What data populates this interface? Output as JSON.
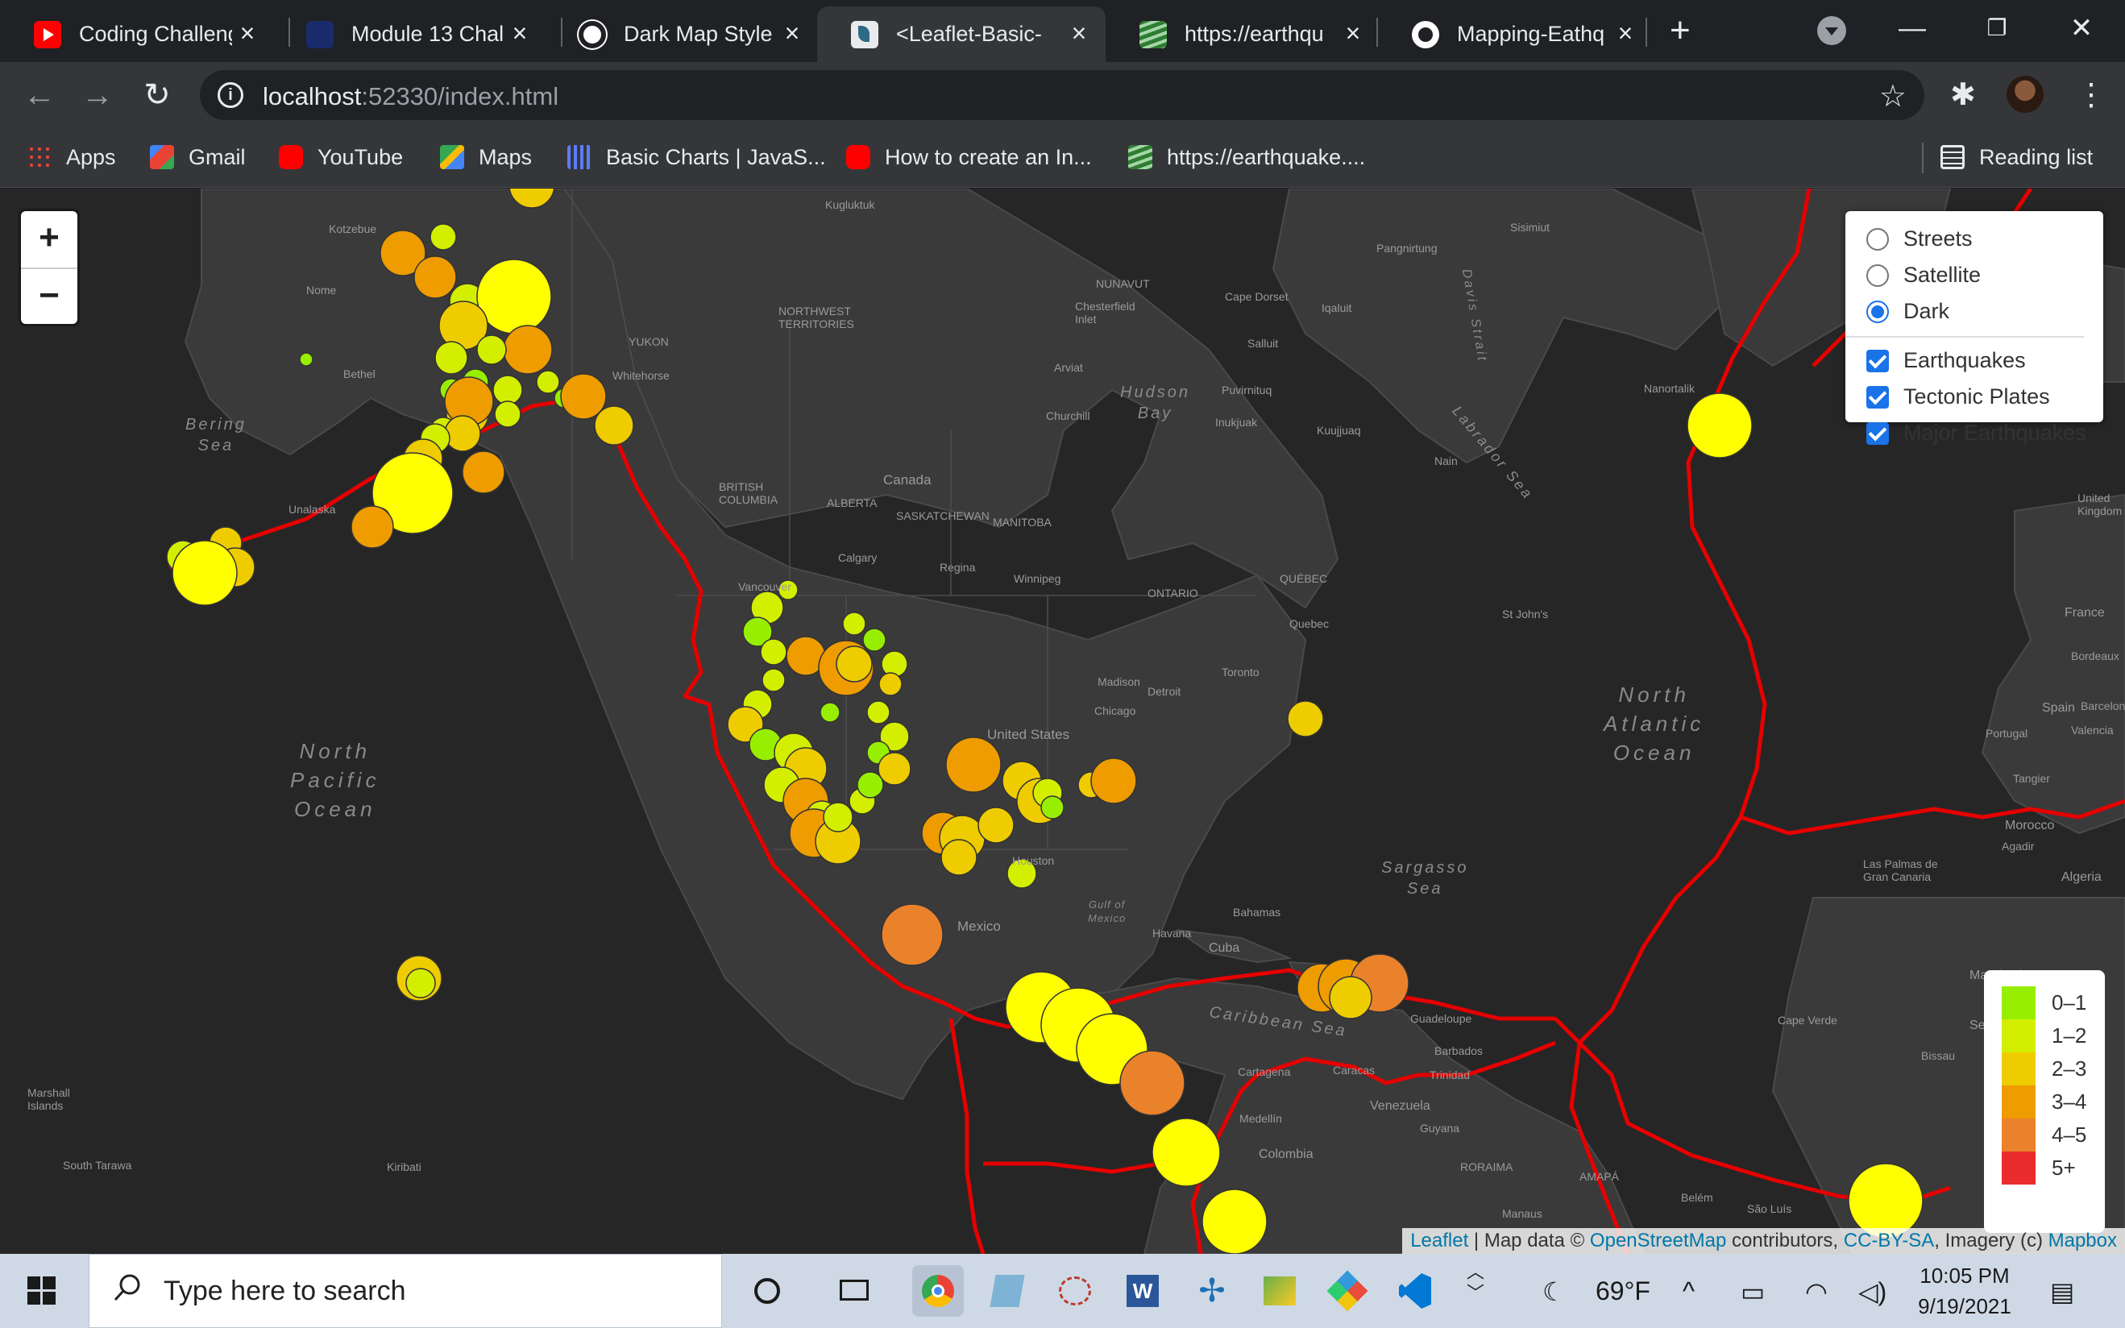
{
  "browser": {
    "tabs": [
      {
        "label": "Coding Challeng",
        "icon": "youtube-icon",
        "active": false
      },
      {
        "label": "Module 13 Chal",
        "icon": "module-icon",
        "active": false
      },
      {
        "label": "Dark Map Style",
        "icon": "mapbox-icon",
        "active": false
      },
      {
        "label": "<Leaflet-Basic-",
        "icon": "leaflet-icon",
        "active": true
      },
      {
        "label": "https://earthqu",
        "icon": "usgs-icon",
        "active": false
      },
      {
        "label": "Mapping-Eathq",
        "icon": "github-icon",
        "active": false
      }
    ],
    "new_tab": "+",
    "url_host": "localhost",
    "url_rest": ":52330/index.html",
    "bookmarks": [
      {
        "label": "Apps"
      },
      {
        "label": "Gmail"
      },
      {
        "label": "YouTube"
      },
      {
        "label": "Maps"
      },
      {
        "label": "Basic Charts | JavaS..."
      },
      {
        "label": "How to create an In..."
      },
      {
        "label": "https://earthquake...."
      }
    ],
    "reading_list": "Reading list"
  },
  "map": {
    "zoom_in": "+",
    "zoom_out": "−",
    "layers": {
      "base": [
        {
          "label": "Streets",
          "checked": false
        },
        {
          "label": "Satellite",
          "checked": false
        },
        {
          "label": "Dark",
          "checked": true
        }
      ],
      "overlays": [
        {
          "label": "Earthquakes",
          "checked": true
        },
        {
          "label": "Tectonic Plates",
          "checked": true
        },
        {
          "label": "Major Earthquakes",
          "checked": true
        }
      ]
    },
    "legend": [
      {
        "label": "0–1",
        "color": "#98ee00"
      },
      {
        "label": "1–2",
        "color": "#d4ee00"
      },
      {
        "label": "2–3",
        "color": "#eecc00"
      },
      {
        "label": "3–4",
        "color": "#ee9c00"
      },
      {
        "label": "4–5",
        "color": "#ea822c"
      },
      {
        "label": "5+",
        "color": "#ea2c2c"
      }
    ],
    "ocean_labels": {
      "north_pacific": "North\nPacific\nOcean",
      "north_atlantic": "North\nAtlantic\nOcean",
      "bering": "Bering\nSea",
      "hudson": "Hudson\nBay",
      "caribbean": "Caribbean Sea",
      "sargasso": "Sargasso\nSea",
      "labrador": "Labrador Sea",
      "davis": "Davis Strait",
      "gulf": "Gulf of\nMexico"
    },
    "place_labels": {
      "canada": "Canada",
      "united_states": "United States",
      "mexico": "Mexico",
      "venezuela": "Venezuela",
      "colombia": "Colombia",
      "cuba": "Cuba",
      "havana": "Havana",
      "calgary": "Calgary",
      "vancouver": "Vancouver",
      "chicago": "Chicago",
      "detroit": "Detroit",
      "toronto": "Toronto",
      "quebec": "Quebec",
      "houston": "Houston",
      "medellin": "Medellín",
      "caracas": "Caracas",
      "belem": "Belém",
      "sao_luis": "São Luís",
      "manaus": "Manaus",
      "st_johns": "St John's",
      "nome": "Nome",
      "bethel": "Bethel",
      "kotzebue": "Kotzebue",
      "whitehorse": "Whitehorse",
      "yukon": "YUKON",
      "nunavut": "NUNAVUT",
      "alberta": "ALBERTA",
      "ontario": "ONTARIO",
      "quebec_prov": "QUÉBEC",
      "manitoba": "MANITOBA",
      "saskatchewan": "SASKATCHEWAN",
      "bc": "BRITISH\nCOLUMBIA",
      "nwt": "NORTHWEST\nTERRITORIES",
      "winnipeg": "Winnipeg",
      "regina": "Regina",
      "churchill": "Churchill",
      "iqaluit": "Iqaluit",
      "kugluktuk": "Kugluktuk",
      "salluit": "Salluit",
      "inukjuak": "Inukjuak",
      "puvirnituq": "Puvirnituq",
      "kuujjuaq": "Kuujjuaq",
      "nain": "Nain",
      "nanortalik": "Nanortalik",
      "sisimiut": "Sisimiut",
      "pangnirtung": "Pangnirtung",
      "cape_dorset": "Cape Dorset",
      "chesterfield": "Chesterfield\nInlet",
      "arviat": "Arviat",
      "marshall": "Marshall\nIslands",
      "south_tarawa": "South Tarawa",
      "kiribati": "Kiribati",
      "madison": "Madison",
      "france": "France",
      "spain": "Spain",
      "portugal": "Portugal",
      "morocco": "Morocco",
      "algeria": "Algeria",
      "senegal": "Senegal",
      "mauritania": "Mauritania",
      "united_kingdom": "United\nKingdom",
      "bordeaux": "Bordeaux",
      "barcelona": "Barcelona",
      "valencia": "Valencia",
      "tangier": "Tangier",
      "agadir": "Agadir",
      "las_palmas": "Las Palmas de\nGran Canaria",
      "cape_verde": "Cape Verde",
      "bissau": "Bissau",
      "guyana": "Guyana",
      "roraima": "RORAIMA",
      "amapa": "AMAPÁ",
      "trinidad": "Trinidad",
      "barbados": "Barbados",
      "guadeloupe": "Guadeloupe",
      "bahamas": "Bahamas",
      "cartagena": "Cartagena",
      "unalaska": "Unalaska"
    },
    "attribution": {
      "leaflet": "Leaflet",
      "mid": " | Map data © ",
      "osm": "OpenStreetMap",
      "contrib": " contributors, ",
      "license": "CC-BY-SA",
      "imagery": ", Imagery (c) ",
      "mapbox": "Mapbox"
    }
  },
  "taskbar": {
    "search_placeholder": "Type here to search",
    "weather": "69°F",
    "time": "10:05 PM",
    "date": "9/19/2021"
  }
}
